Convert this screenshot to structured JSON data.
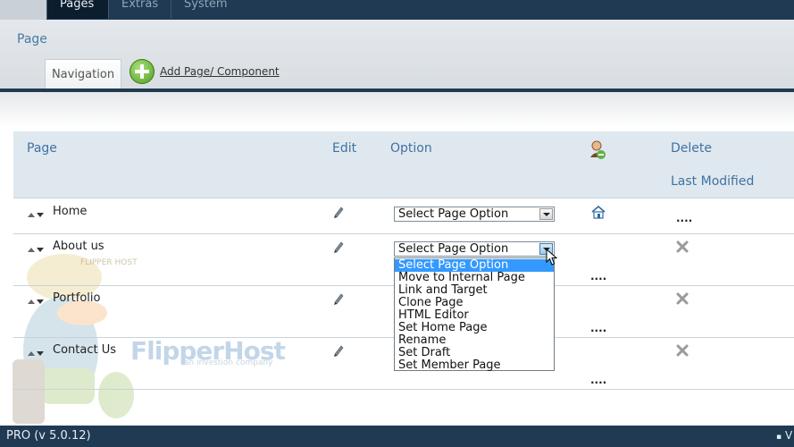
{
  "top_nav": {
    "tabs": [
      "Pages",
      "Extras",
      "System"
    ]
  },
  "panel": {
    "title": "Page",
    "nav_tab": "Navigation",
    "add_link": "Add Page/ Component"
  },
  "table": {
    "headers": {
      "page": "Page",
      "edit": "Edit",
      "option": "Option",
      "delete": "Delete",
      "last_modified": "Last Modified"
    },
    "rows": [
      {
        "name": "Home",
        "select_value": "Select Page Option",
        "last_modified": "...."
      },
      {
        "name": "About us",
        "select_value": "Select Page Option",
        "last_modified": "...."
      },
      {
        "name": "Portfolio",
        "last_modified": "...."
      },
      {
        "name": "Contact Us",
        "last_modified": "...."
      }
    ]
  },
  "dropdown": {
    "selected_index": 0,
    "options": [
      "Select Page Option",
      "Move to Internal Page",
      "Link and Target",
      "Clone Page",
      "HTML Editor",
      "Set Home Page",
      "Rename",
      "Set Draft",
      "Set Member Page"
    ]
  },
  "watermark": {
    "brand": "FlipperHost",
    "tagline": "an investion company",
    "mascot_cap": "FLIPPER HOST"
  },
  "footer": {
    "version": "PRO (v 5.0.12)",
    "right_text": "V"
  },
  "colors": {
    "nav_bg": "#1f3a52",
    "header_text": "#3f72a0",
    "dropdown_highlight": "#3399ff",
    "add_icon": "#4e9a1e"
  }
}
